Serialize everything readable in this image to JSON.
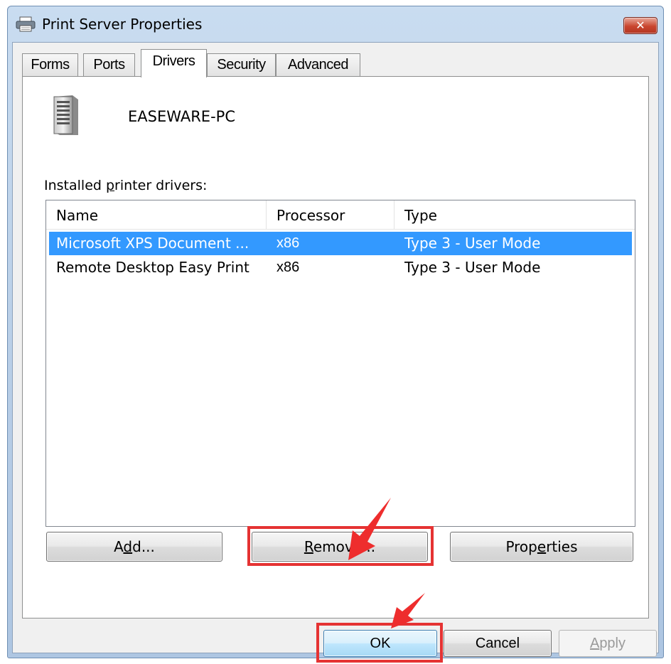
{
  "window": {
    "title": "Print Server Properties",
    "close_label": "✕"
  },
  "tabs": [
    {
      "label": "Forms",
      "active": false
    },
    {
      "label": "Ports",
      "active": false
    },
    {
      "label": "Drivers",
      "active": true
    },
    {
      "label": "Security",
      "active": false
    },
    {
      "label": "Advanced",
      "active": false
    }
  ],
  "server": {
    "name": "EASEWARE-PC",
    "icon": "server-tower-icon"
  },
  "drivers": {
    "label_pre": "Installed ",
    "label_underline": "p",
    "label_post": "rinter drivers:",
    "columns": [
      "Name",
      "Processor",
      "Type"
    ],
    "rows": [
      {
        "name": "Microsoft XPS Document ...",
        "processor": "x86",
        "type": "Type 3 - User Mode",
        "selected": true
      },
      {
        "name": "Remote Desktop Easy Print",
        "processor": "x86",
        "type": "Type 3 - User Mode",
        "selected": false
      }
    ]
  },
  "buttons": {
    "add": {
      "pre": "A",
      "u": "d",
      "post": "d..."
    },
    "remove": {
      "pre": "",
      "u": "R",
      "post": "emove..."
    },
    "properties": {
      "pre": "Prop",
      "u": "e",
      "post": "rties"
    },
    "ok": "OK",
    "cancel": "Cancel",
    "apply": {
      "pre": "",
      "u": "A",
      "post": "pply"
    }
  },
  "colors": {
    "selection": "#3399ff",
    "highlight_box": "#e53333",
    "titlebar": "#c9dcf0",
    "close_button": "#c9452f"
  }
}
